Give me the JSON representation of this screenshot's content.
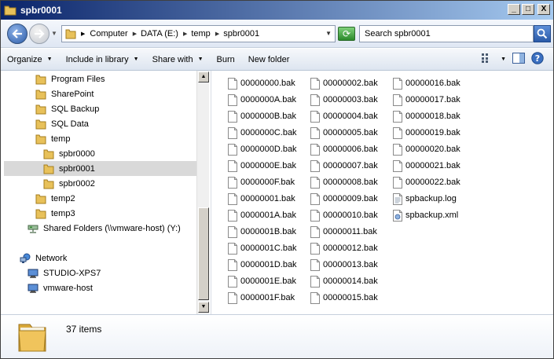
{
  "window": {
    "title": "spbr0001",
    "minimize_label": "_",
    "maximize_label": "□",
    "close_label": "X"
  },
  "address_bar": {
    "crumbs": [
      "Computer",
      "DATA (E:)",
      "temp",
      "spbr0001"
    ],
    "search_placeholder": "Search spbr0001"
  },
  "command_bar": {
    "organize": "Organize",
    "include_in_library": "Include in library",
    "share_with": "Share with",
    "burn": "Burn",
    "new_folder": "New folder"
  },
  "nav_tree": [
    {
      "label": "Program Files",
      "icon": "folder-icon"
    },
    {
      "label": "SharePoint",
      "icon": "folder-icon"
    },
    {
      "label": "SQL Backup",
      "icon": "folder-icon"
    },
    {
      "label": "SQL Data",
      "icon": "folder-icon"
    },
    {
      "label": "temp",
      "icon": "folder-icon"
    },
    {
      "label": "spbr0000",
      "icon": "folder-icon"
    },
    {
      "label": "spbr0001",
      "icon": "folder-icon",
      "selected": true
    },
    {
      "label": "spbr0002",
      "icon": "folder-icon"
    },
    {
      "label": "temp2",
      "icon": "folder-icon"
    },
    {
      "label": "temp3",
      "icon": "folder-icon"
    },
    {
      "label": "Shared Folders (\\\\vmware-host) (Y:)",
      "icon": "network-drive-icon"
    },
    {
      "label": "Network",
      "icon": "network-icon"
    },
    {
      "label": "STUDIO-XPS7",
      "icon": "computer-icon"
    },
    {
      "label": "vmware-host",
      "icon": "computer-icon"
    }
  ],
  "files": [
    {
      "name": "00000000.bak",
      "type": "bak"
    },
    {
      "name": "0000000A.bak",
      "type": "bak"
    },
    {
      "name": "0000000B.bak",
      "type": "bak"
    },
    {
      "name": "0000000C.bak",
      "type": "bak"
    },
    {
      "name": "0000000D.bak",
      "type": "bak"
    },
    {
      "name": "0000000E.bak",
      "type": "bak"
    },
    {
      "name": "0000000F.bak",
      "type": "bak"
    },
    {
      "name": "00000001.bak",
      "type": "bak"
    },
    {
      "name": "0000001A.bak",
      "type": "bak"
    },
    {
      "name": "0000001B.bak",
      "type": "bak"
    },
    {
      "name": "0000001C.bak",
      "type": "bak"
    },
    {
      "name": "0000001D.bak",
      "type": "bak"
    },
    {
      "name": "0000001E.bak",
      "type": "bak"
    },
    {
      "name": "0000001F.bak",
      "type": "bak"
    },
    {
      "name": "00000002.bak",
      "type": "bak"
    },
    {
      "name": "00000003.bak",
      "type": "bak"
    },
    {
      "name": "00000004.bak",
      "type": "bak"
    },
    {
      "name": "00000005.bak",
      "type": "bak"
    },
    {
      "name": "00000006.bak",
      "type": "bak"
    },
    {
      "name": "00000007.bak",
      "type": "bak"
    },
    {
      "name": "00000008.bak",
      "type": "bak"
    },
    {
      "name": "00000009.bak",
      "type": "bak"
    },
    {
      "name": "00000010.bak",
      "type": "bak"
    },
    {
      "name": "00000011.bak",
      "type": "bak"
    },
    {
      "name": "00000012.bak",
      "type": "bak"
    },
    {
      "name": "00000013.bak",
      "type": "bak"
    },
    {
      "name": "00000014.bak",
      "type": "bak"
    },
    {
      "name": "00000015.bak",
      "type": "bak"
    },
    {
      "name": "00000016.bak",
      "type": "bak"
    },
    {
      "name": "00000017.bak",
      "type": "bak"
    },
    {
      "name": "00000018.bak",
      "type": "bak"
    },
    {
      "name": "00000019.bak",
      "type": "bak"
    },
    {
      "name": "00000020.bak",
      "type": "bak"
    },
    {
      "name": "00000021.bak",
      "type": "bak"
    },
    {
      "name": "00000022.bak",
      "type": "bak"
    },
    {
      "name": "spbackup.log",
      "type": "log"
    },
    {
      "name": "spbackup.xml",
      "type": "xml"
    }
  ],
  "status": {
    "item_count": "37 items"
  },
  "colors": {
    "folder": "#e8c15a",
    "selection": "#d9d9d9",
    "title_gradient_start": "#0a246a"
  }
}
